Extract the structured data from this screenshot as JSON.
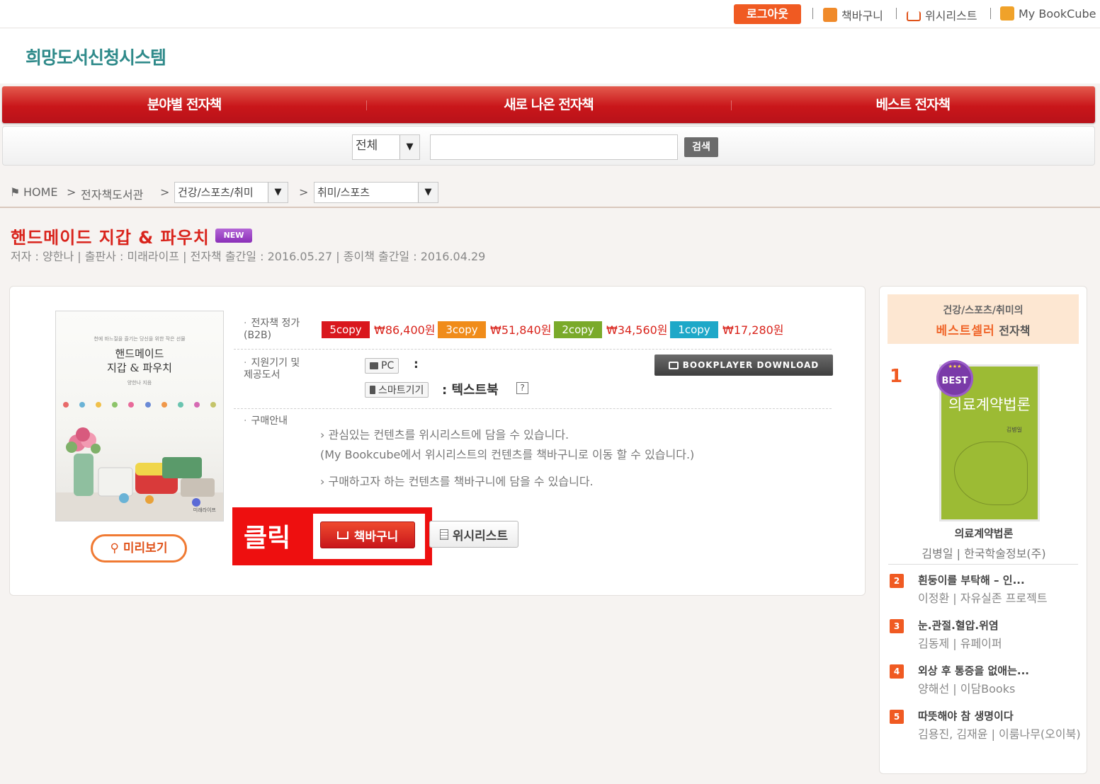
{
  "topbar": {
    "logout_label": "로그아웃",
    "cart_label": "책바구니",
    "wishlist_label": "위시리스트",
    "mybookcube_label": "My BookCube"
  },
  "header": {
    "site_title": "희망도서신청시스템"
  },
  "main_nav": {
    "tabs": [
      {
        "label": "분야별 전자책"
      },
      {
        "label": "새로 나온 전자책"
      },
      {
        "label": "베스트 전자책"
      }
    ]
  },
  "search": {
    "category_selected": "전체",
    "query": "",
    "button_label": "검색"
  },
  "breadcrumb": {
    "home": "HOME",
    "library": "전자책도서관",
    "category_selected": "건강/스포츠/취미",
    "subcategory_selected": "취미/스포츠",
    "separator": ">"
  },
  "book": {
    "title": "핸드메이드 지갑 & 파우치",
    "badge": "NEW",
    "meta": "저자 : 양한나 | 출판사 : 미래라이프 | 전자책 출간일 : 2016.05.27 | 종이책 출간일 : 2016.04.29",
    "cover": {
      "subtitle": "천에 바느질을 즐기는 당신을 위한 작은 선물",
      "title_line1": "핸드메이드",
      "title_line2": "지갑 & 파우치",
      "author": "양한나 지음",
      "publisher": "미래라이프"
    },
    "preview_label": "미리보기",
    "price_label": "전자책 정가\n(B2B)",
    "prices": [
      {
        "copy": "5copy",
        "price": "₩86,400원",
        "color": "#d9171d"
      },
      {
        "copy": "3copy",
        "price": "₩51,840원",
        "color": "#f08c1a"
      },
      {
        "copy": "2copy",
        "price": "₩34,560원",
        "color": "#7aaa2a"
      },
      {
        "copy": "1copy",
        "price": "₩17,280원",
        "color": "#1ea8c8"
      }
    ],
    "device_label": "지원기기 및\n제공도서",
    "devices": [
      {
        "name": "PC",
        "value": ":"
      },
      {
        "name": "스마트기기",
        "value": ": 텍스트북"
      }
    ],
    "help_mark": "?",
    "bookplayer_label": "BOOKPLAYER DOWNLOAD",
    "purchase_label": "구매안내",
    "purchase_info": [
      "관심있는 컨텐츠를 위시리스트에 담을 수 있습니다.",
      "(My Bookcube에서 위시리스트의 컨텐츠를 책바구니로 이동 할 수 있습니다.)",
      "구매하고자 하는 컨텐츠를 책바구니에 담을 수 있습니다."
    ],
    "click_annotation": "클릭",
    "cart_button_label": "책바구니",
    "wishlist_button_label": "위시리스트"
  },
  "sidebar": {
    "category": "건강/스포츠/취미의",
    "bestseller_highlight": "베스트셀러",
    "bestseller_suffix": "전자책",
    "top": {
      "rank": "1",
      "badge": "BEST",
      "cover_title": "의료계약법론",
      "cover_author": "김병일",
      "title": "의료계약법론",
      "author": "김병일 | 한국학술정보(주)"
    },
    "items": [
      {
        "rank": "2",
        "title": "흰둥이를 부탁해 – 인...",
        "author": "이정환 | 자유실존 프로젝트"
      },
      {
        "rank": "3",
        "title": "눈.관절.혈압.위염",
        "author": "김동제 | 유페이퍼"
      },
      {
        "rank": "4",
        "title": "외상 후 통증을 없애는...",
        "author": "양해선 | 이담Books"
      },
      {
        "rank": "5",
        "title": "따뜻해야 참 생명이다",
        "author": "김용진, 김재윤 | 이룸나무(오이북)"
      }
    ]
  },
  "colors": {
    "accent_red": "#d9241c",
    "orange": "#f05a22",
    "teal_title": "#2f8a8a"
  }
}
